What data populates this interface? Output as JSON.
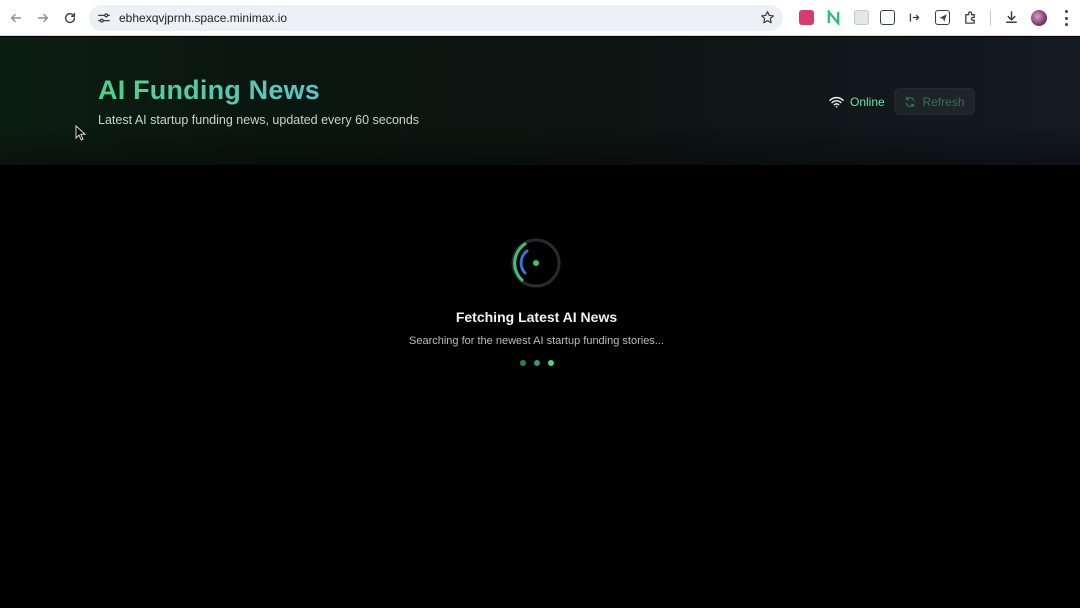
{
  "browser": {
    "url": "ebhexqvjprnh.space.minimax.io",
    "nav_icons": [
      "back-arrow-icon",
      "forward-arrow-icon",
      "reload-icon"
    ],
    "extensions": [
      {
        "name": "extension-1-icon",
        "color": "#d63b6e"
      },
      {
        "name": "extension-n-icon",
        "color": "#27c07a"
      },
      {
        "name": "extension-3-icon",
        "color": "#9aa0a6"
      },
      {
        "name": "extension-4-icon",
        "color": "#3c4043"
      },
      {
        "name": "extension-5-icon",
        "color": "#3c4043"
      },
      {
        "name": "extension-send-icon",
        "color": "#3c4043"
      },
      {
        "name": "extensions-puzzle-icon",
        "color": "#3c4043"
      }
    ]
  },
  "header": {
    "title": "AI Funding News",
    "subtitle": "Latest AI startup funding news, updated every 60 seconds",
    "status": "Online",
    "refresh_label": "Refresh"
  },
  "loading": {
    "title": "Fetching Latest AI News",
    "subtitle": "Searching for the newest AI startup funding stories..."
  },
  "colors": {
    "accent_green": "#4fd08a",
    "accent_teal": "#5fc3c8",
    "status_green": "#6fe3a4",
    "spinner_blue": "#3a6fd8",
    "background": "#000000"
  }
}
